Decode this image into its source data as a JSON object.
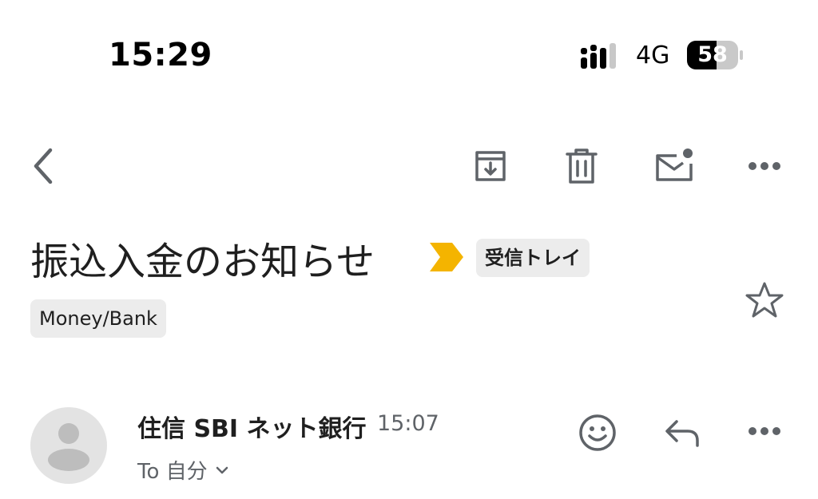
{
  "status_bar": {
    "time": "15:29",
    "network": "4G",
    "battery": "58"
  },
  "toolbar": {
    "icons": [
      "back-icon",
      "archive-icon",
      "trash-icon",
      "mark-unread-icon",
      "more-icon"
    ]
  },
  "email": {
    "subject": "振込入金のお知らせ",
    "importance_marker_color": "#f4b400",
    "folder_chip": "受信トレイ",
    "label_chip": "Money/Bank",
    "sender_name": "住信 SBI ネット銀行",
    "sent_time": "15:07",
    "recipient_line": "To 自分"
  },
  "actions": {
    "icons": [
      "star-icon",
      "emoji-reaction-icon",
      "reply-icon",
      "more-icon"
    ]
  },
  "colors": {
    "icon_gray": "#5f6368",
    "chip_bg": "#ececec",
    "avatar_bg": "#e3e3e3",
    "avatar_fg": "#bdbdbd"
  }
}
